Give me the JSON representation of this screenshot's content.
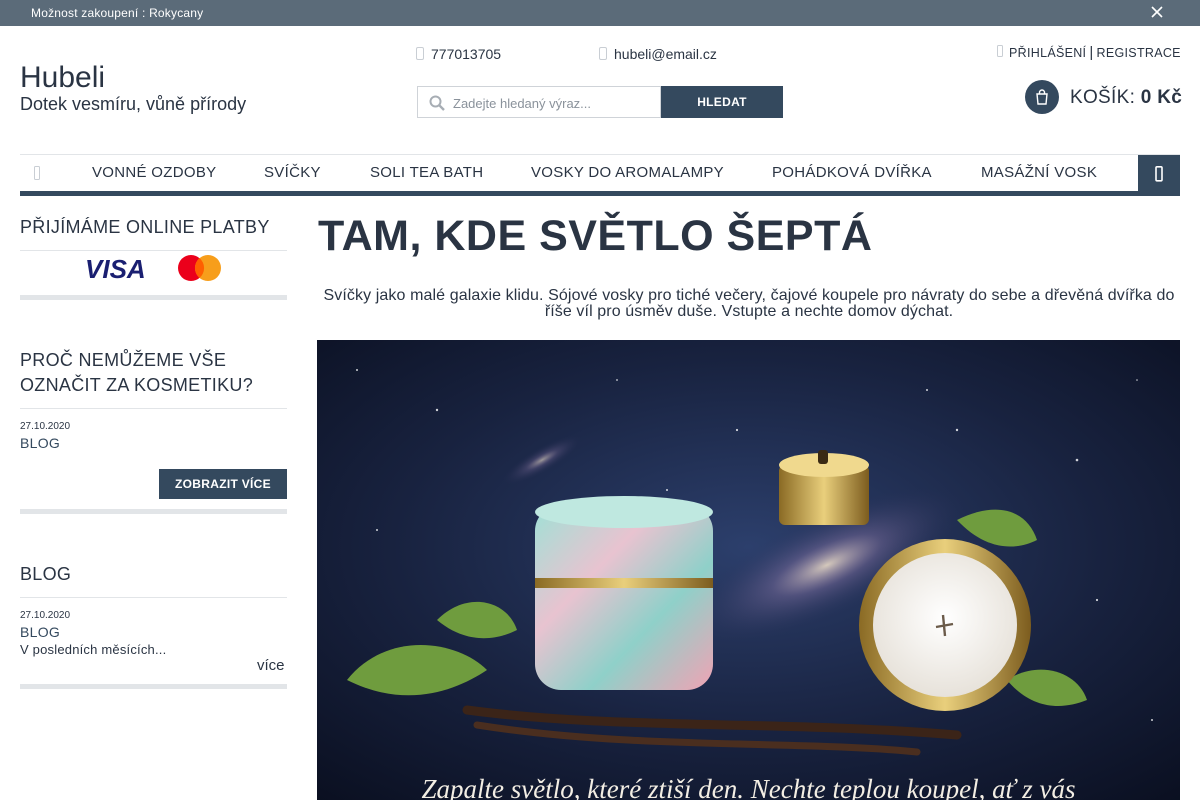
{
  "topbar": {
    "message": "Možnost zakoupení : Rokycany"
  },
  "brand": {
    "name": "Hubeli",
    "tagline": "Dotek vesmíru, vůně přírody"
  },
  "contact": {
    "phone": "777013705",
    "email": "hubeli@email.cz"
  },
  "search": {
    "placeholder": "Zadejte hledaný výraz...",
    "button_label": "HLEDAT"
  },
  "account": {
    "login_label": "PŘIHLÁŠENÍ",
    "separator": "|",
    "register_label": "REGISTRACE"
  },
  "cart": {
    "label": "KOŠÍK:",
    "amount": "0 Kč"
  },
  "nav": {
    "items": [
      "VONNÉ OZDOBY",
      "SVÍČKY",
      "SOLI TEA BATH",
      "VOSKY DO AROMALAMPY",
      "POHÁDKOVÁ DVÍŘKA",
      "MASÁŽNÍ VOSK"
    ]
  },
  "sidebar": {
    "payments": {
      "title": "PŘIJÍMÁME ONLINE PLATBY",
      "logos": [
        "VISA",
        "mastercard"
      ]
    },
    "cosmetics": {
      "title_line1": "PROČ NEMŮŽEME VŠE",
      "title_line2": "OZNAČIT ZA KOSMETIKU?",
      "date": "27.10.2020",
      "category": "BLOG",
      "button_label": "ZOBRAZIT VÍCE"
    },
    "blog": {
      "title": "BLOG",
      "date": "27.10.2020",
      "category": "BLOG",
      "excerpt": "V posledních měsících...",
      "more_label": "více"
    }
  },
  "main": {
    "title": "TAM, KDE SVĚTLO ŠEPTÁ",
    "intro": "Svíčky jako malé galaxie klidu. Sójové vosky pro tiché večery, čajové koupele pro návraty do sebe a dřevěná dvířka do říše víl pro úsměv duše. Vstupte a nechte domov dýchat.",
    "hero_caption": "Zapalte světlo, které ztiší den. Nechte teplou koupel, ať z vás"
  },
  "colors": {
    "accent": "#34495e",
    "topbar": "#5b6b79",
    "text": "#2a3443",
    "mastercard_red": "#eb001b",
    "mastercard_orange": "#f79e1b"
  }
}
